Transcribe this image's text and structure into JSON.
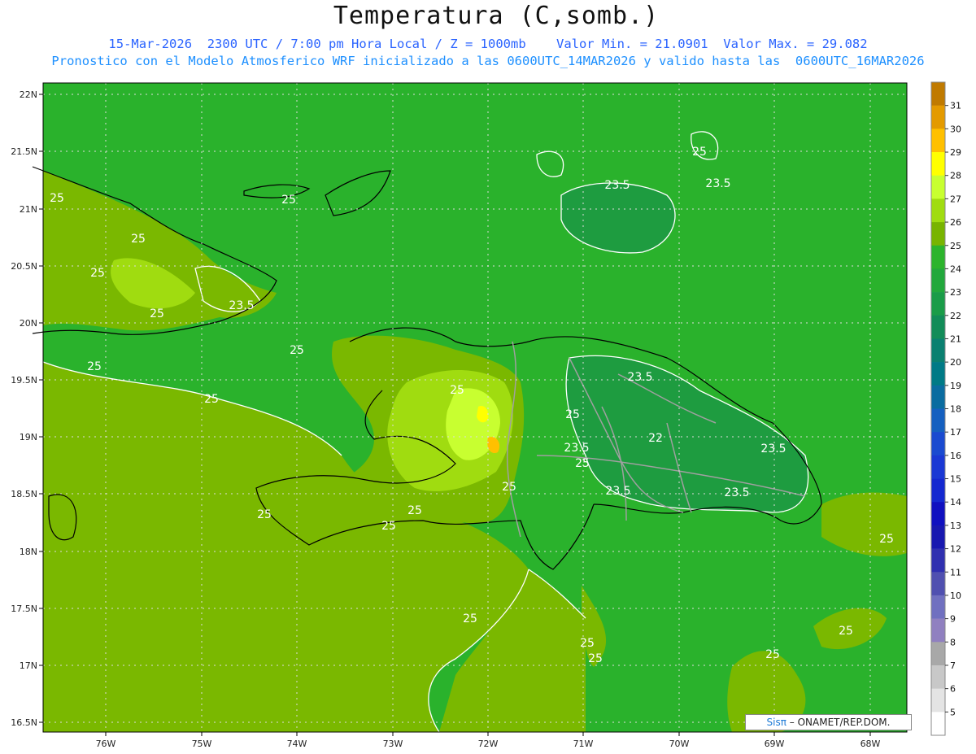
{
  "header": {
    "title": "Temperatura (C,somb.)",
    "line1": "15-Mar-2026  2300 UTC / 7:00 pm Hora Local / Z = 1000mb    Valor Min. = 21.0901  Valor Max. = 29.082",
    "line2": "Pronostico con el Modelo Atmosferico WRF inicializado a las 0600UTC_14MAR2026 y valido hasta las  0600UTC_16MAR2026"
  },
  "axes": {
    "lat_labels": [
      "22N",
      "21.5N",
      "21N",
      "20.5N",
      "20N",
      "19.5N",
      "19N",
      "18.5N",
      "18N",
      "17.5N",
      "17N",
      "16.5N"
    ],
    "lon_labels": [
      "76W",
      "75W",
      "74W",
      "73W",
      "72W",
      "71W",
      "70W",
      "69W",
      "68W"
    ]
  },
  "colorbar": {
    "labels": [
      "31",
      "30",
      "29",
      "28",
      "27",
      "26",
      "25",
      "24",
      "23",
      "22",
      "21",
      "20",
      "19",
      "18",
      "17",
      "16",
      "15",
      "14",
      "13",
      "12",
      "11",
      "10",
      "9",
      "8",
      "7",
      "6",
      "5"
    ],
    "colors": [
      "#c07a00",
      "#e49a00",
      "#ffc000",
      "#ffff00",
      "#c8ff30",
      "#a0dc10",
      "#78b400",
      "#2cb42c",
      "#22a83c",
      "#1a9c48",
      "#128c58",
      "#0a8070",
      "#007a86",
      "#0a6ca0",
      "#1560c0",
      "#1a4ad0",
      "#1a38d4",
      "#1428d0",
      "#1010c0",
      "#1818b0",
      "#3030b0",
      "#5050b0",
      "#7070c0",
      "#9080c0",
      "#a8a8a8",
      "#c8c8c8",
      "#e4e4e4",
      "#ffffff"
    ]
  },
  "contour_labels": [
    "25",
    "25",
    "25",
    "25",
    "25",
    "23.5",
    "25",
    "25",
    "25",
    "23.5",
    "23.5",
    "23.5",
    "25",
    "25",
    "23.5",
    "22",
    "23.5",
    "25",
    "25",
    "23.5",
    "23.5",
    "25",
    "25",
    "25",
    "25",
    "25",
    "25",
    "25",
    "25",
    "25",
    "25"
  ],
  "credit": {
    "brand": "Sisπ",
    "text": " – ONAMET/REP.DOM."
  }
}
